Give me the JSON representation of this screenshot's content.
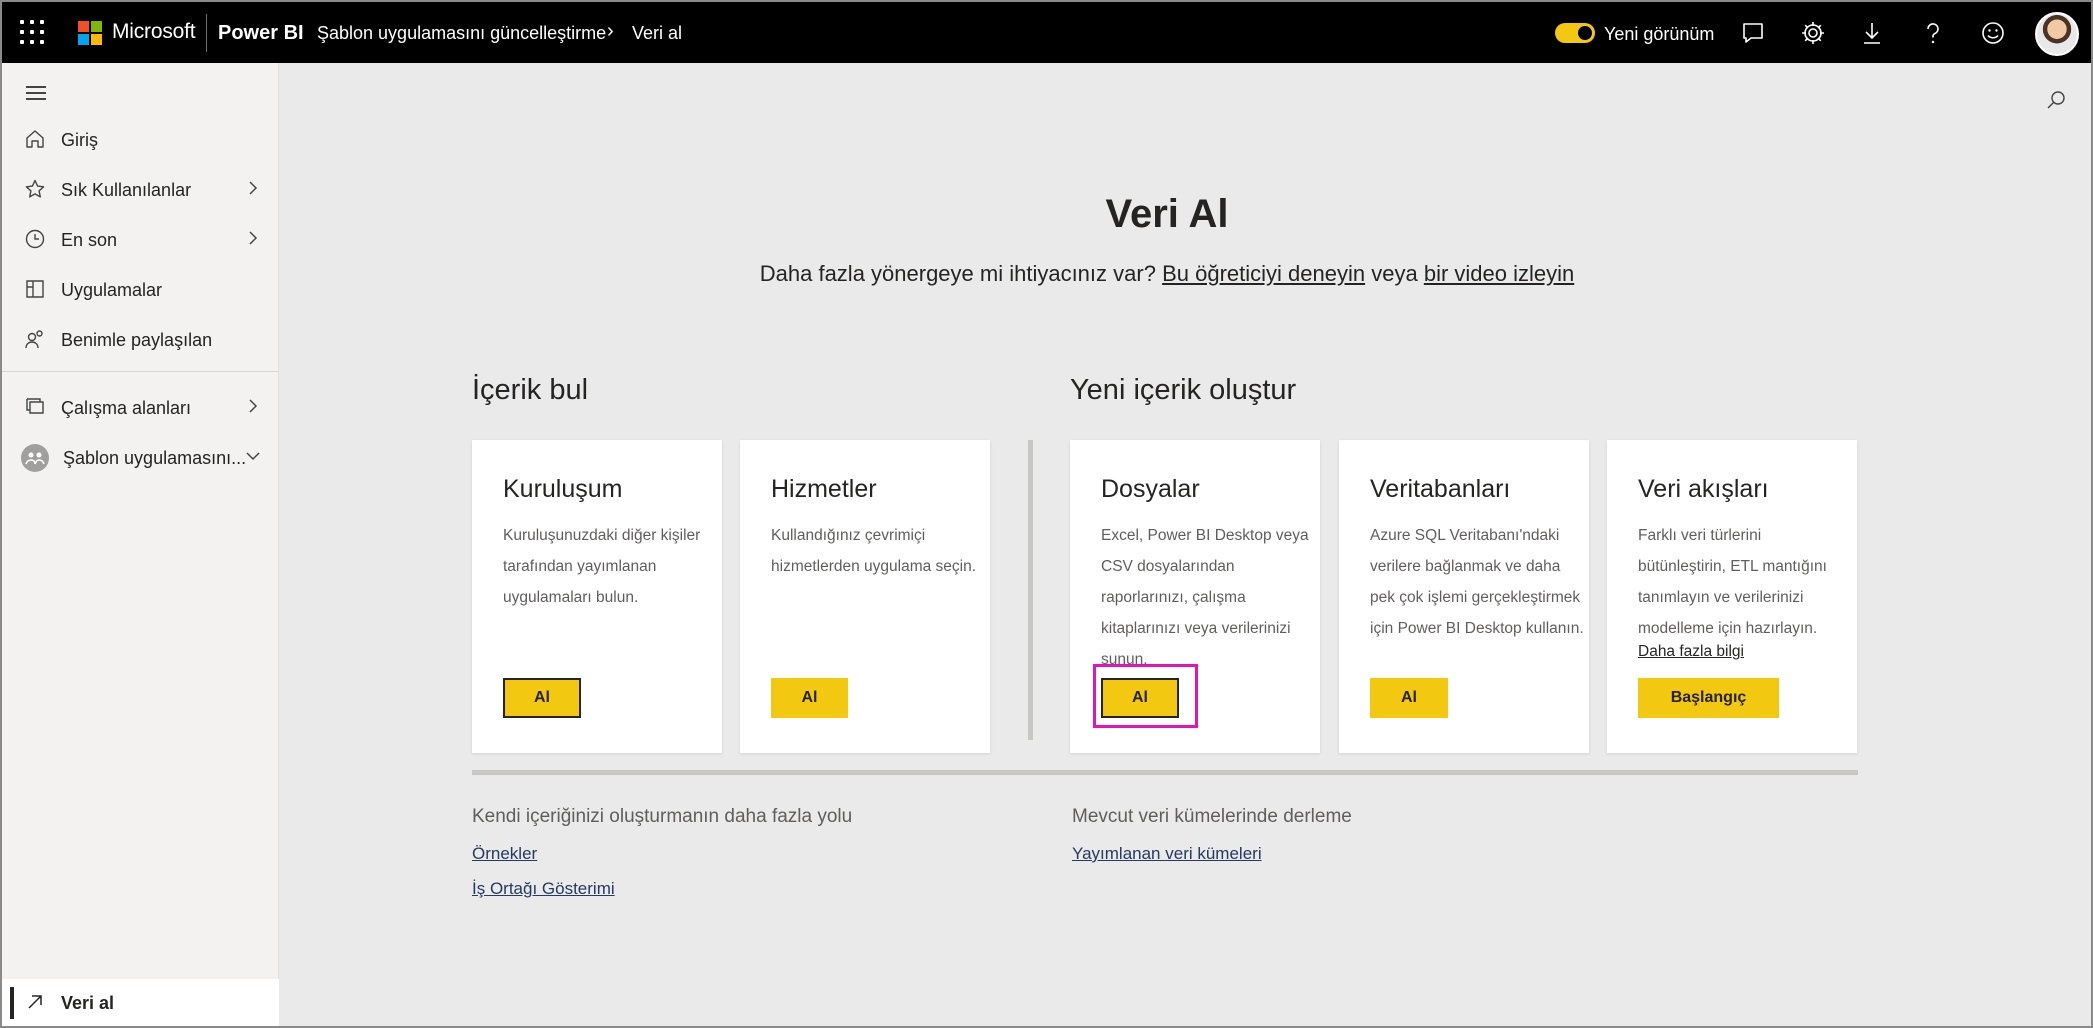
{
  "topbar": {
    "brand": "Microsoft",
    "product": "Power BI",
    "breadcrumb_app": "Şablon uygulamasını güncelleştirme",
    "breadcrumb_page": "Veri al",
    "toggle_label": "Yeni görünüm",
    "accent_color": "#f2c811"
  },
  "sidebar": {
    "items": [
      {
        "label": "Giriş",
        "icon": "home-icon"
      },
      {
        "label": "Sık Kullanılanlar",
        "icon": "star-icon"
      },
      {
        "label": "En son",
        "icon": "clock-icon"
      },
      {
        "label": "Uygulamalar",
        "icon": "apps-icon"
      },
      {
        "label": "Benimle paylaşılan",
        "icon": "shared-icon"
      },
      {
        "label": "Çalışma alanları",
        "icon": "workspaces-icon"
      },
      {
        "label": "Şablon uygulamasını...",
        "icon": "app-workspace-icon"
      }
    ],
    "get_data": "Veri al"
  },
  "main": {
    "title": "Veri Al",
    "subtitle_prefix": "Daha fazla yönergeye mi ihtiyacınız var?",
    "subtitle_link1": "Bu öğreticiyi deneyin",
    "subtitle_mid": "veya",
    "subtitle_link2": "bir video izleyin",
    "find_content": "İçerik bul",
    "create_content": "Yeni içerik oluştur",
    "cards": [
      {
        "title": "Kuruluşum",
        "desc": "Kuruluşunuzdaki diğer kişiler tarafından yayımlanan uygulamaları bulun.",
        "button": "Al"
      },
      {
        "title": "Hizmetler",
        "desc": "Kullandığınız çevrimiçi hizmetlerden uygulama seçin.",
        "button": "Al"
      },
      {
        "title": "Dosyalar",
        "desc": "Excel, Power BI Desktop veya CSV dosyalarından raporlarınızı, çalışma kitaplarınızı veya verilerinizi sunun.",
        "button": "Al"
      },
      {
        "title": "Veritabanları",
        "desc": "Azure SQL Veritabanı'ndaki verilere bağlanmak ve daha pek çok işlemi gerçekleştirmek için Power BI Desktop kullanın.",
        "button": "Al"
      },
      {
        "title": "Veri akışları",
        "desc": "Farklı veri türlerini bütünleştirin, ETL mantığını tanımlayın ve verilerinizi modelleme için hazırlayın.",
        "more": "Daha fazla bilgi",
        "button": "Başlangıç"
      }
    ],
    "more_ways": "Kendi içeriğinizi oluşturmanın daha fazla yolu",
    "samples": "Örnekler",
    "partner": "İş Ortağı Gösterimi",
    "existing": "Mevcut veri kümelerinde derleme",
    "published": "Yayımlanan veri kümeleri"
  }
}
